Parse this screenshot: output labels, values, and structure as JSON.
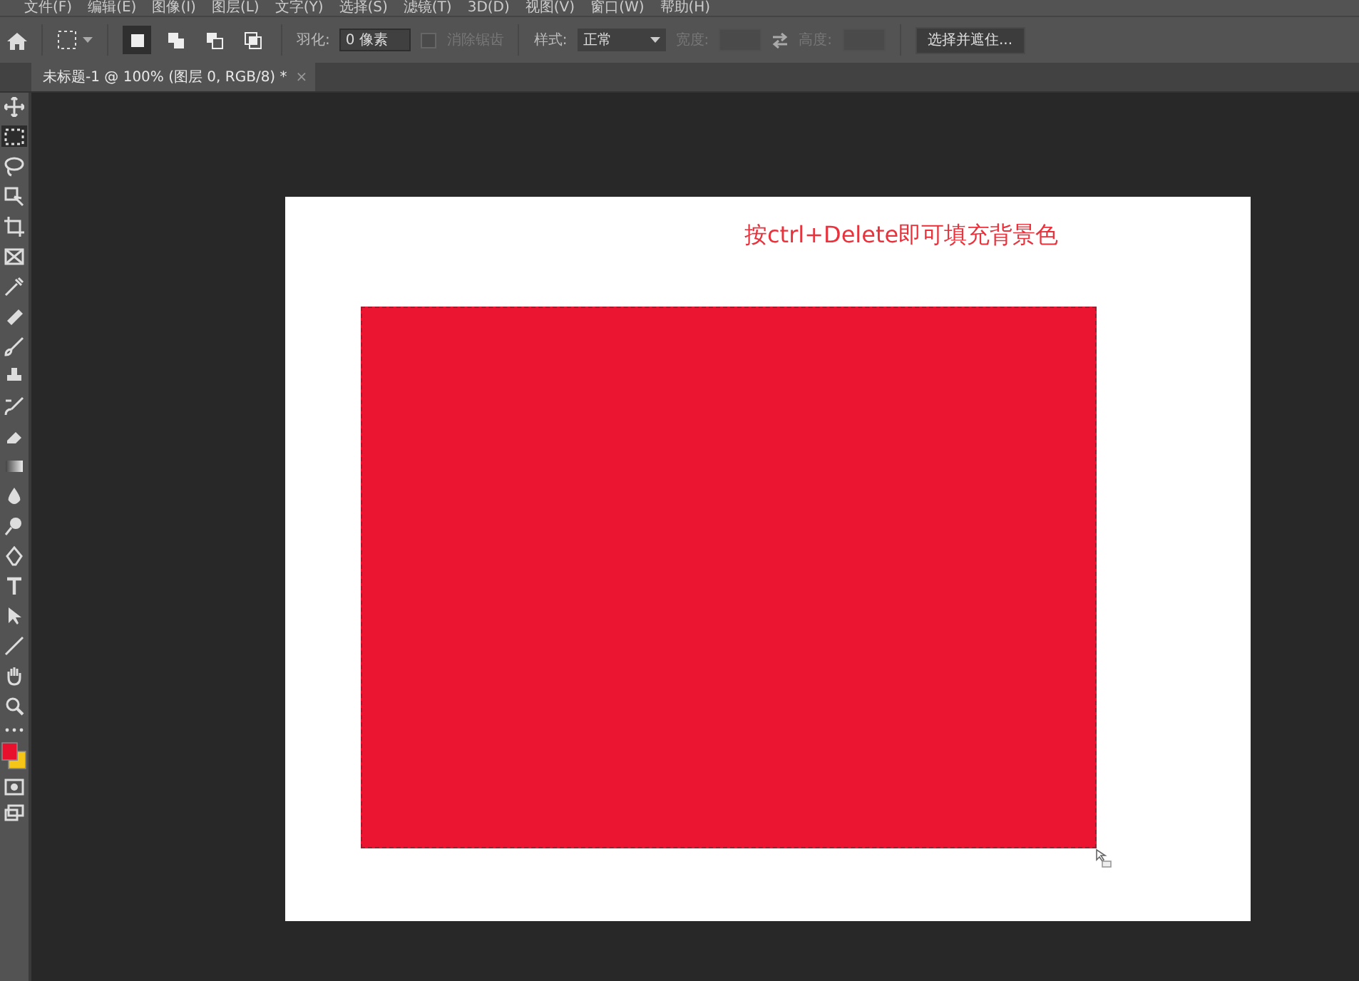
{
  "menu_bar": {
    "items": [
      "文件(F)",
      "编辑(E)",
      "图像(I)",
      "图层(L)",
      "文字(Y)",
      "选择(S)",
      "滤镜(T)",
      "3D(D)",
      "视图(V)",
      "窗口(W)",
      "帮助(H)"
    ]
  },
  "options_bar": {
    "selection_modes": [
      {
        "selected": true
      },
      {
        "selected": false
      },
      {
        "selected": false
      },
      {
        "selected": false
      }
    ],
    "feather": {
      "label": "羽化:",
      "value": "0 像素"
    },
    "anti_alias": {
      "label": "消除锯齿",
      "checked": false,
      "disabled": true
    },
    "style": {
      "label": "样式:",
      "value": "正常"
    },
    "width": {
      "label": "宽度:",
      "disabled": true
    },
    "height": {
      "label": "高度:",
      "disabled": true
    },
    "select_mask_button": "选择并遮住..."
  },
  "document_tab": {
    "title": "未标题-1 @ 100% (图层 0, RGB/8) *",
    "close": "×",
    "selected": true
  },
  "tools": [
    {
      "selected": false
    },
    {
      "selected": true
    },
    {
      "selected": false
    },
    {
      "selected": false
    },
    {
      "selected": false
    },
    {
      "selected": false
    },
    {
      "selected": false
    },
    {
      "selected": false
    },
    {
      "selected": false
    },
    {
      "selected": false
    },
    {
      "selected": false
    },
    {
      "selected": false
    },
    {
      "selected": false
    },
    {
      "selected": false
    },
    {
      "selected": false
    },
    {
      "selected": false
    },
    {
      "selected": false
    },
    {
      "selected": false
    },
    {
      "selected": false
    },
    {
      "selected": false
    },
    {
      "selected": false
    }
  ],
  "canvas": {
    "annotation": "按ctrl+Delete即可填充背景色"
  }
}
